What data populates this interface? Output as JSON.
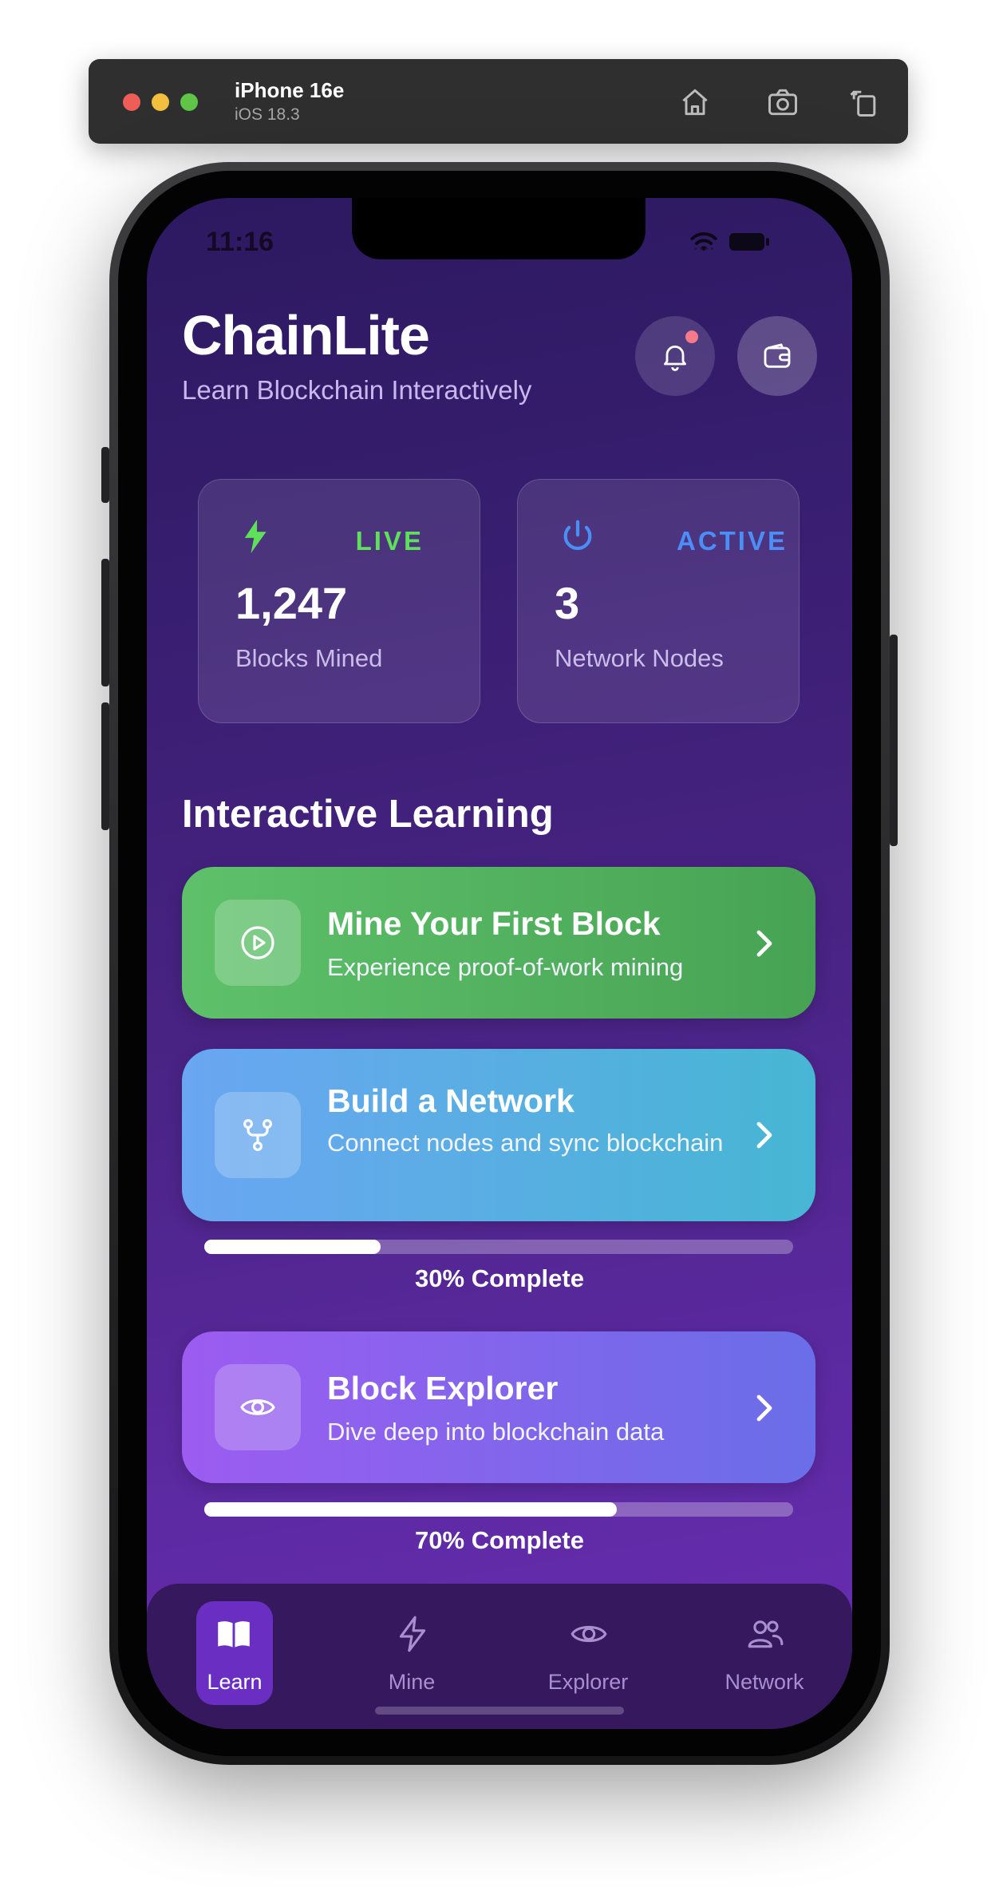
{
  "simulator": {
    "device_name": "iPhone 16e",
    "os_version": "iOS 18.3",
    "icons": [
      "home-icon",
      "screenshot-icon",
      "rotate-icon"
    ]
  },
  "status_bar": {
    "time": "11:16"
  },
  "header": {
    "title": "ChainLite",
    "subtitle": "Learn Blockchain Interactively",
    "notification_badge_color": "#f77a8c"
  },
  "stats": [
    {
      "badge": "LIVE",
      "badge_color": "#5ee05a",
      "icon": "bolt-icon",
      "value": "1,247",
      "label": "Blocks Mined"
    },
    {
      "badge": "ACTIVE",
      "badge_color": "#4a8ef6",
      "icon": "power-icon",
      "value": "3",
      "label": "Network Nodes"
    }
  ],
  "section_title": "Interactive Learning",
  "courses": [
    {
      "title": "Mine Your First Block",
      "description": "Experience proof-of-work mining",
      "icon": "play-circle-icon",
      "color_from": "#5ec16a",
      "color_to": "#47a354"
    },
    {
      "title": "Build a Network",
      "description": "Connect nodes and sync blockchain",
      "icon": "fork-icon",
      "color_from": "#6aa6f2",
      "color_to": "#47b6d3",
      "progress": 0.3,
      "progress_text": "30% Complete"
    },
    {
      "title": "Block Explorer",
      "description": "Dive deep into blockchain data",
      "icon": "eye-icon",
      "color_from": "#9c5cf0",
      "color_to": "#6a6ee8",
      "progress": 0.7,
      "progress_text": "70% Complete"
    }
  ],
  "tabs": [
    {
      "label": "Learn",
      "icon": "book-icon",
      "active": true
    },
    {
      "label": "Mine",
      "icon": "bolt-icon",
      "active": false
    },
    {
      "label": "Explorer",
      "icon": "eye-icon",
      "active": false
    },
    {
      "label": "Network",
      "icon": "people-icon",
      "active": false
    }
  ]
}
